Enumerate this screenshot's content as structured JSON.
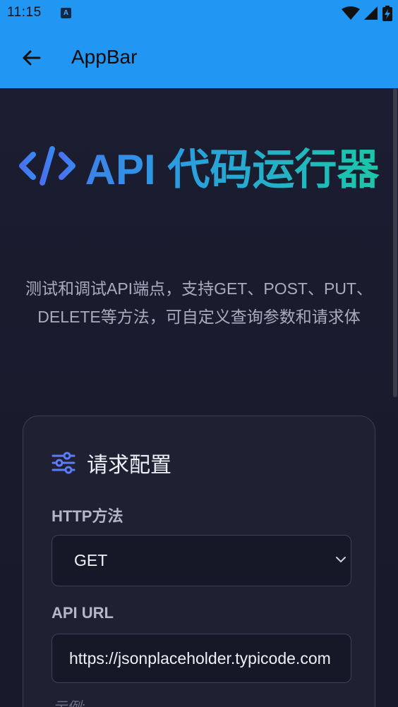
{
  "status_bar": {
    "time": "11:15",
    "notification_icon": "A"
  },
  "app_bar": {
    "title": "AppBar"
  },
  "hero": {
    "title": "API 代码运行器"
  },
  "subtitle": "测试和调试API端点，支持GET、POST、PUT、DELETE等方法，可自定义查询参数和请求体",
  "card": {
    "title": "请求配置",
    "method_label": "HTTP方法",
    "method_value": "GET",
    "url_label": "API URL",
    "url_value": "https://jsonplaceholder.typicode.com",
    "hint": "示例:"
  },
  "colors": {
    "app_bar": "#2196f3",
    "background": "#1a1c2c",
    "accent_blue": "#4a6ff0",
    "accent_teal": "#1cc7a8"
  }
}
